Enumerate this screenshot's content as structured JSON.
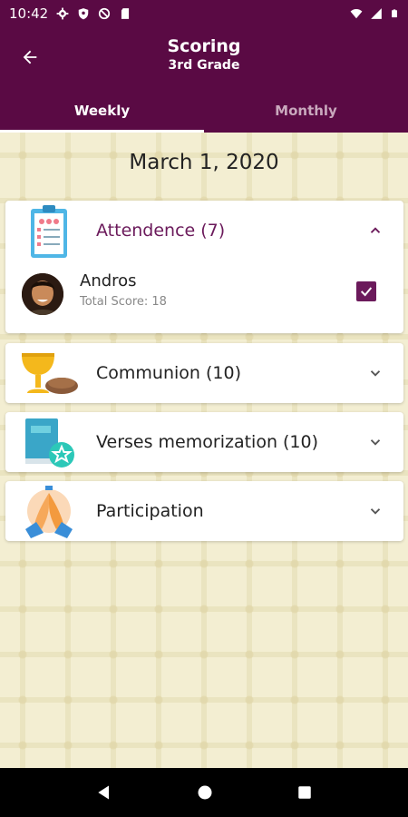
{
  "status_bar": {
    "time": "10:42",
    "left_icons": [
      "gear-icon",
      "shield-icon",
      "no-symbol-icon",
      "sd-card-icon"
    ],
    "right_icons": [
      "wifi-icon",
      "signal-icon",
      "battery-icon"
    ]
  },
  "app_bar": {
    "title": "Scoring",
    "subtitle": "3rd Grade",
    "back_icon": "arrow-left-icon"
  },
  "tabs": [
    {
      "label": "Weekly",
      "active": true
    },
    {
      "label": "Monthly",
      "active": false
    }
  ],
  "date": "March 1, 2020",
  "sections": [
    {
      "title": "Attendence (7)",
      "icon": "clipboard-icon",
      "expanded": true,
      "members": [
        {
          "name": "Andros",
          "score": "Total Score: 18",
          "checked": true
        }
      ]
    },
    {
      "title": "Communion (10)",
      "icon": "chalice-bread-icon",
      "expanded": false
    },
    {
      "title": "Verses memorization (10)",
      "icon": "book-star-icon",
      "expanded": false
    },
    {
      "title": "Participation",
      "icon": "praying-hands-icon",
      "expanded": false
    }
  ],
  "colors": {
    "primary": "#5a0a44",
    "accent": "#6b1a5b",
    "background": "#f3eed2"
  },
  "nav_bar": [
    "back-triangle-icon",
    "home-circle-icon",
    "recents-square-icon"
  ]
}
